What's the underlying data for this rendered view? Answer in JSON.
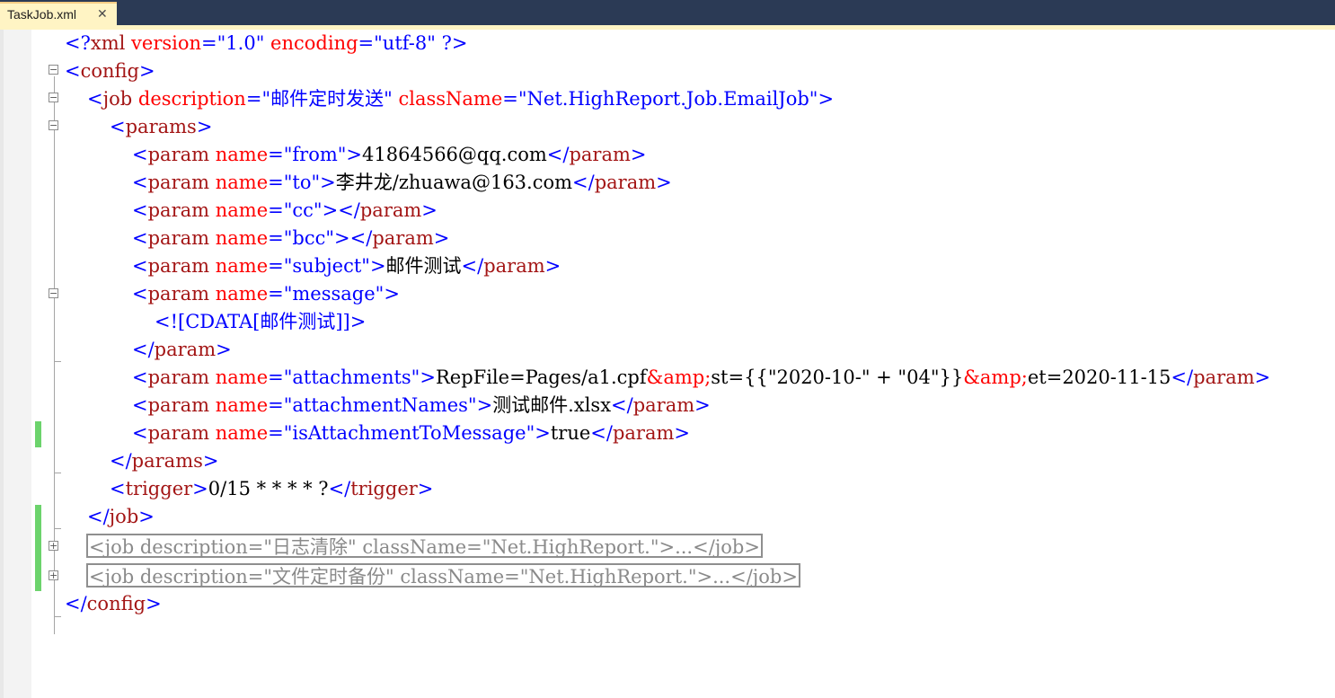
{
  "tab": {
    "title": "TaskJob.xml",
    "close": "✕"
  },
  "lines": {
    "l1": {
      "lt": "<?",
      "name": "xml",
      "a1": "version",
      "eq1": "=",
      "v1": "\"1.0\"",
      "a2": "encoding",
      "eq2": "=",
      "v2": "\"utf-8\"",
      "end": "?>"
    },
    "l2": {
      "lt": "<",
      "name": "config",
      "gt": ">"
    },
    "l3": {
      "lt": "<",
      "name": "job",
      "a1": "description",
      "eq1": "=",
      "v1": "\"邮件定时发送\"",
      "a2": "className",
      "eq2": "=",
      "v2": "\"Net.HighReport.Job.EmailJob\"",
      "gt": ">"
    },
    "l4": {
      "lt": "<",
      "name": "params",
      "gt": ">"
    },
    "l5": {
      "lt": "<",
      "name": "param",
      "a": "name",
      "eq": "=",
      "v": "\"from\"",
      "gt": ">",
      "text": "41864566@qq.com",
      "clt": "</",
      "cname": "param",
      "cgt": ">"
    },
    "l6": {
      "lt": "<",
      "name": "param",
      "a": "name",
      "eq": "=",
      "v": "\"to\"",
      "gt": ">",
      "text": "李井龙/zhuawa@163.com",
      "clt": "</",
      "cname": "param",
      "cgt": ">"
    },
    "l7": {
      "lt": "<",
      "name": "param",
      "a": "name",
      "eq": "=",
      "v": "\"cc\"",
      "gt": ">",
      "clt": "</",
      "cname": "param",
      "cgt": ">"
    },
    "l8": {
      "lt": "<",
      "name": "param",
      "a": "name",
      "eq": "=",
      "v": "\"bcc\"",
      "gt": ">",
      "clt": "</",
      "cname": "param",
      "cgt": ">"
    },
    "l9": {
      "lt": "<",
      "name": "param",
      "a": "name",
      "eq": "=",
      "v": "\"subject\"",
      "gt": ">",
      "text": "邮件测试",
      "clt": "</",
      "cname": "param",
      "cgt": ">"
    },
    "l10": {
      "lt": "<",
      "name": "param",
      "a": "name",
      "eq": "=",
      "v": "\"message\"",
      "gt": ">"
    },
    "l11": {
      "cdata": "<![CDATA[邮件测试]]>"
    },
    "l12": {
      "lt": "</",
      "name": "param",
      "gt": ">"
    },
    "l13": {
      "lt": "<",
      "name": "param",
      "a": "name",
      "eq": "=",
      "v": "\"attachments\"",
      "gt": ">",
      "t1": "RepFile=Pages/a1.cpf",
      "e1": "&amp;",
      "t2": "st={{\"2020-10-\" + \"04\"}}",
      "e2": "&amp;",
      "t3": "et=2020-11-15",
      "clt": "</",
      "cname": "param",
      "cgt": ">"
    },
    "l14": {
      "lt": "<",
      "name": "param",
      "a": "name",
      "eq": "=",
      "v": "\"attachmentNames\"",
      "gt": ">",
      "text": "测试邮件.xlsx",
      "clt": "</",
      "cname": "param",
      "cgt": ">"
    },
    "l15": {
      "lt": "<",
      "name": "param",
      "a": "name",
      "eq": "=",
      "v": "\"isAttachmentToMessage\"",
      "gt": ">",
      "text": "true",
      "clt": "</",
      "cname": "param",
      "cgt": ">"
    },
    "l16": {
      "lt": "</",
      "name": "params",
      "gt": ">"
    },
    "l17": {
      "lt": "<",
      "name": "trigger",
      "gt": ">",
      "text": "0/15 * * * * ?",
      "clt": "</",
      "cname": "trigger",
      "cgt": ">"
    },
    "l18": {
      "lt": "</",
      "name": "job",
      "gt": ">"
    },
    "l19": {
      "text": "<job description=\"日志清除\" className=\"Net.HighReport.\">...</job>"
    },
    "l20": {
      "text": "<job description=\"文件定时备份\" className=\"Net.HighReport.\">...</job>"
    },
    "l21": {
      "lt": "</",
      "name": "config",
      "gt": ">"
    }
  },
  "fold": {
    "minus": "−",
    "plus": "+"
  },
  "colors": {
    "tag_bracket": "#0000ff",
    "element": "#a31515",
    "attribute": "#ff0000",
    "value": "#0000ff",
    "collapsed": "#808080",
    "change_bar": "#6cd36c",
    "tab_bg": "#fff4c4"
  }
}
